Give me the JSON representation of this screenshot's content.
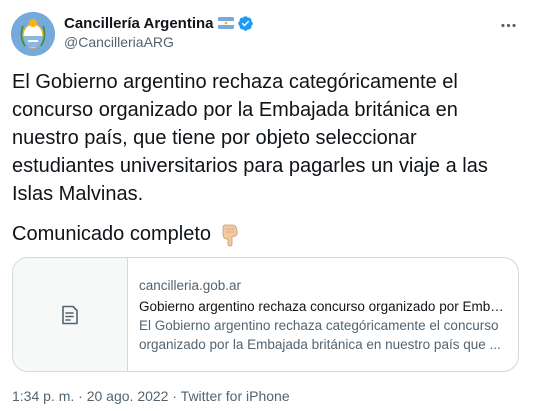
{
  "author": {
    "name": "Cancillería Argentina",
    "handle": "@CancilleriaARG",
    "flag_icon": "argentina-flag-icon",
    "verified_icon": "verified-badge-icon",
    "verified_color": "#1d9bf0",
    "avatar_color": "#75aadb"
  },
  "tweet": {
    "text": "El Gobierno argentino rechaza categóricamente el\nconcurso organizado por la Embajada británica en\nnuestro país, que tiene por objeto seleccionar\nestudiantes universitarios para pagarles un viaje a las\nIslas Malvinas.",
    "cta": "Comunicado completo",
    "cta_icon": "backhand-index-pointing-down-icon"
  },
  "link_card": {
    "domain": "cancilleria.gob.ar",
    "title": "Gobierno argentino rechaza concurso organizado por Embaj...",
    "description_line1": "El Gobierno argentino rechaza categóricamente el concurso",
    "description_line2": "organizado por la Embajada británica en nuestro país que ...",
    "thumb_icon": "document-icon"
  },
  "meta": {
    "time": "1:34 p. m.",
    "separator": " · ",
    "date": "20 ago. 2022",
    "source": "Twitter for iPhone"
  },
  "more_icon": "more-options-icon"
}
